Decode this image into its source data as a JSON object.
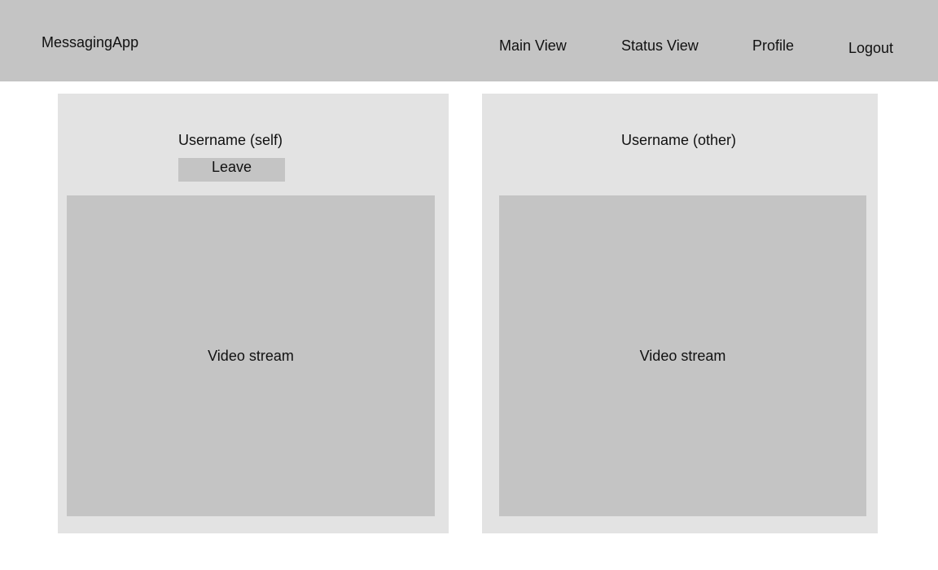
{
  "nav": {
    "brand": "MessagingApp",
    "links": [
      "Main View",
      "Status View",
      "Profile",
      "Logout"
    ]
  },
  "self_panel": {
    "username": "Username (self)",
    "leave_label": "Leave",
    "video_label": "Video stream"
  },
  "other_panel": {
    "username": "Username (other)",
    "video_label": "Video stream"
  }
}
